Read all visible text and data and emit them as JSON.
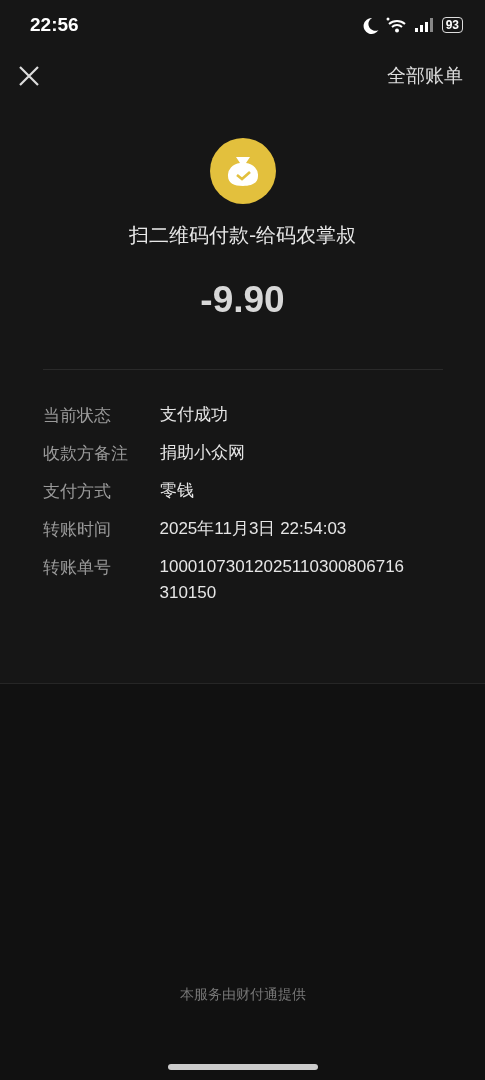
{
  "status_bar": {
    "time": "22:56",
    "battery": "93"
  },
  "nav": {
    "right_link": "全部账单"
  },
  "merchant": {
    "title": "扫二维码付款-给码农掌叔"
  },
  "amount": "-9.90",
  "details": [
    {
      "label": "当前状态",
      "value": "支付成功"
    },
    {
      "label": "收款方备注",
      "value": "捐助小众网"
    },
    {
      "label": "支付方式",
      "value": "零钱"
    },
    {
      "label": "转账时间",
      "value": "2025年11月3日 22:54:03"
    },
    {
      "label": "转账单号",
      "value": "10001073012025110300806716310150"
    }
  ],
  "footer": "本服务由财付通提供"
}
